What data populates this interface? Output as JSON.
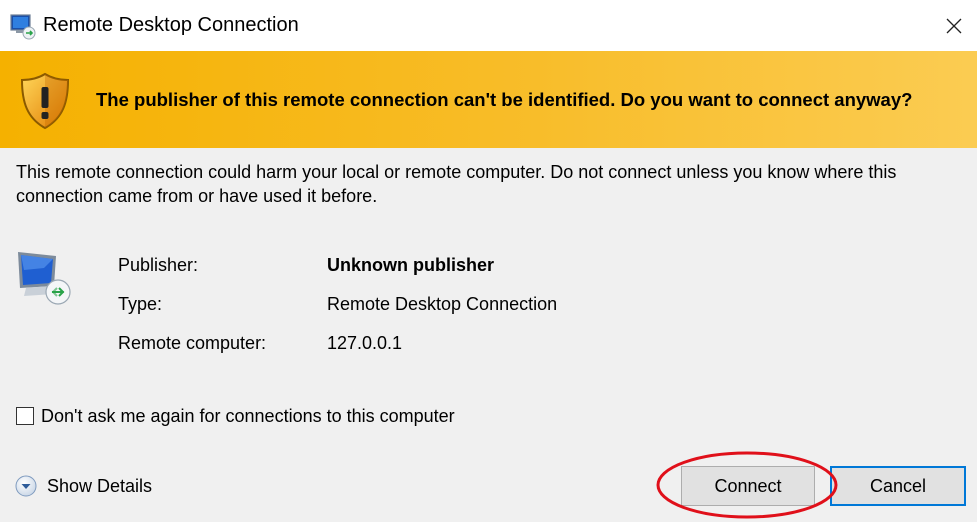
{
  "window": {
    "title": "Remote Desktop Connection",
    "close_glyph": "✕"
  },
  "banner": {
    "text": "The publisher of this remote connection can't be identified. Do you want to connect anyway?",
    "icon": "shield-warning-icon"
  },
  "warning_text": "This remote connection could harm your local or remote computer. Do not connect unless you know where this connection came from or have used it before.",
  "details": {
    "icon": "remote-computer-icon",
    "rows": [
      {
        "label": "Publisher:",
        "value": "Unknown publisher"
      },
      {
        "label": "Type:",
        "value": "Remote Desktop Connection"
      },
      {
        "label": "Remote computer:",
        "value": "127.0.0.1"
      }
    ]
  },
  "dont_ask": {
    "label": "Don't ask me again for connections to this computer",
    "checked": false
  },
  "show_details": {
    "label": "Show Details"
  },
  "buttons": {
    "connect": "Connect",
    "cancel": "Cancel"
  },
  "colors": {
    "banner": "#f5b100",
    "highlight": "#e0101a",
    "focus": "#0078d7"
  }
}
